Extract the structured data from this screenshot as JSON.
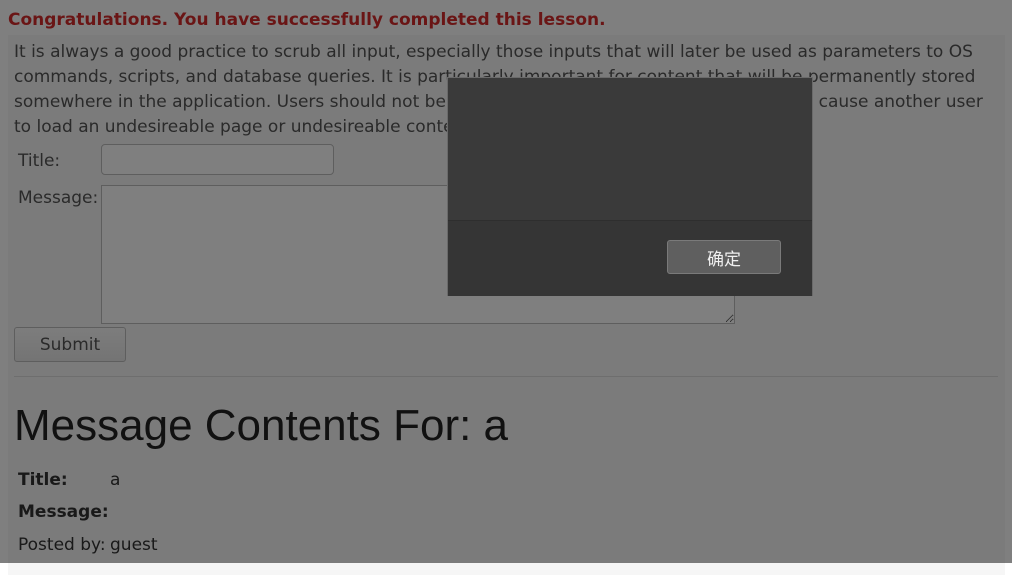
{
  "lesson": {
    "success_message": "Congratulations. You have successfully completed this lesson.",
    "description": "It is always a good practice to scrub all input, especially those inputs that will later be used as parameters to OS commands, scripts, and database queries. It is particularly important for content that will be permanently stored somewhere in the application. Users should not be able to create message content that could cause another user to load an undesireable page or undesireable content when the user's message is retrieved."
  },
  "form": {
    "title_label": "Title:",
    "title_value": "",
    "message_label": "Message:",
    "message_value": "",
    "submit_label": "Submit"
  },
  "message_contents": {
    "heading": "Message Contents For: a",
    "title_label": "Title:",
    "title_value": "a",
    "message_label": "Message:",
    "message_value": "",
    "posted_by_label": "Posted by:",
    "posted_by_value": "guest"
  },
  "alert_dialog": {
    "message": "",
    "ok_label": "确定"
  }
}
